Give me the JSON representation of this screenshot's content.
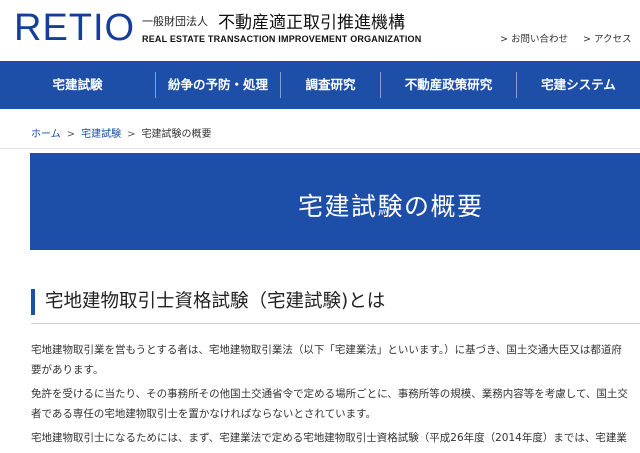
{
  "header": {
    "logo": "RETIO",
    "org_prefix": "一般財団法人",
    "org_name_ja": "不動産適正取引推進機構",
    "org_name_en": "REAL ESTATE TRANSACTION IMPROVEMENT ORGANIZATION",
    "links": {
      "contact": "> お問い合わせ",
      "access": "> アクセス"
    }
  },
  "nav": {
    "items": [
      {
        "label": "宅建試験"
      },
      {
        "label": "紛争の予防・処理"
      },
      {
        "label": "調査研究"
      },
      {
        "label": "不動産政策研究"
      },
      {
        "label": "宅建システム"
      }
    ]
  },
  "breadcrumb": {
    "home": "ホーム",
    "section": "宅建試験",
    "current": "宅建試験の概要",
    "sep": ">"
  },
  "banner": {
    "title": "宅建試験の概要"
  },
  "content": {
    "heading": "宅地建物取引士資格試験（宅建試験)とは",
    "paragraphs": [
      [
        "宅地建物取引業を営もうとする者は、宅地建物取引業法（以下「宅建業法」といいます。）に基づき、国土交通大臣又は都道府",
        "要があります。"
      ],
      [
        "免許を受けるに当たり、その事務所その他国土交通省令で定める場所ごとに、事務所等の規模、業務内容等を考慮して、国土交",
        "者である専任の宅地建物取引士を置かなければならないとされています。"
      ],
      [
        "宅地建物取引士になるためには、まず、宅建業法で定める宅地建物取引士資格試験（平成26年度（2014年度）までは、宅建業"
      ]
    ]
  },
  "colors": {
    "brand": "#1d4ea8",
    "logo": "#123f9c"
  }
}
